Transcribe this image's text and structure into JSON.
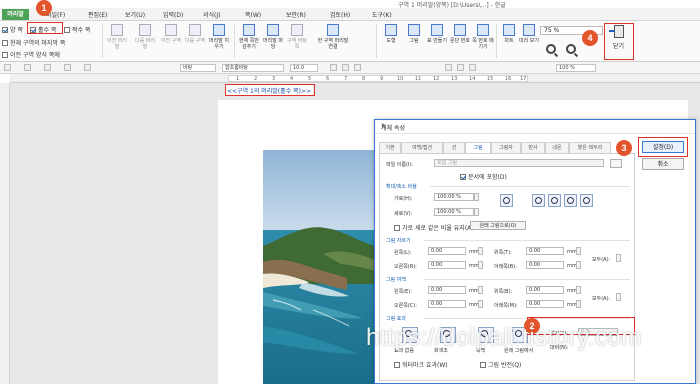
{
  "window": {
    "title": "구역 1 머리말(양쪽) [D:\\Users\\...] - 한글"
  },
  "menu": {
    "active_tab": "머리말",
    "items": [
      "편집(E)",
      "보기(U)",
      "입력(D)",
      "서식(J)",
      "쪽(W)",
      "보안(R)",
      "검토(H)",
      "도구(K)"
    ],
    "hidden_item": "파일(F)"
  },
  "ribbon": {
    "checkboxes": {
      "both": "양 쪽",
      "even": "홀수 쪽",
      "odd": "짝수 쪽",
      "prev_link": "현재 구역의 마지막 쪽",
      "apply": "이전 구역 양식 쪽에"
    },
    "buttons": [
      "이전 머리말",
      "다음 머리말",
      "이전 구역",
      "다음 구역",
      "머리말 지우기",
      "현재 쪽만 감추기",
      "머리말 마당",
      "구역 바탕쪽",
      "한 구역 머리말 연결",
      "도형",
      "그림",
      "표 만들기",
      "문단 번호",
      "쪽 번호 매기기",
      "차트",
      "미리 보기"
    ],
    "zoom": "75 %",
    "close_label": "닫기"
  },
  "format_bar": {
    "style": "바탕",
    "font_size": "10.0",
    "font": "함초롬바탕",
    "zoom_pct": "100 %"
  },
  "ruler": {
    "numbers": [
      "1",
      "2",
      "3",
      "4",
      "5",
      "6",
      "7",
      "8",
      "9",
      "10",
      "11",
      "12",
      "13",
      "14",
      "15",
      "16",
      "17"
    ]
  },
  "document": {
    "header_tag": "<<구역 1의 머리말(홀수 쪽)>>"
  },
  "dialog": {
    "title": "개체 속성",
    "help": "?",
    "close": "×",
    "tabs": [
      "기본",
      "여백/캡션",
      "선",
      "그림",
      "그림자",
      "반사",
      "네온",
      "옅은 테두리"
    ],
    "selected_tab": "그림",
    "file_label": "파일 이름(I):",
    "file_value": "포함 그림",
    "embed_label": "문서에 포함(D)",
    "scale_section": "확대/축소 비율",
    "width_label": "가로(H):",
    "width_value": "100.00 %",
    "height_label": "세로(V):",
    "height_value": "100.00 %",
    "keep_ratio_label": "가로 세로 같은 비율 유지(A)",
    "original_button": "원래 그림으로(O)",
    "crop_section": "그림 자르기",
    "left_label": "왼쪽(L):",
    "right_label": "오른쪽(R):",
    "top_label": "위쪽(T):",
    "bottom_label": "아래쪽(B):",
    "crop_value": "0.00",
    "unit": "mm",
    "all_label": "모두(A):",
    "margin_section": "그림 여백",
    "m_left_label": "왼쪽(E):",
    "m_right_label": "오른쪽(C):",
    "m_top_label": "위쪽(B):",
    "m_bottom_label": "아래쪽(M):",
    "m_value": "0.00",
    "effect_section": "그림 효과",
    "brightness_label": "밝기(X):",
    "brightness_value": "0 %",
    "contrast_label": "대비(N):",
    "effects": [
      "효과 없음",
      "회색조",
      "흑백",
      "원래 그림에서"
    ],
    "watermark_label": "워터마크 효과(W)",
    "invert_label": "그림 반전(Q)",
    "ok_label": "설정(D)",
    "cancel_label": "취소"
  },
  "annotations": {
    "badges": [
      "1",
      "2",
      "3",
      "4"
    ]
  },
  "watermark_text": "https://dolpali.tistory.com"
}
